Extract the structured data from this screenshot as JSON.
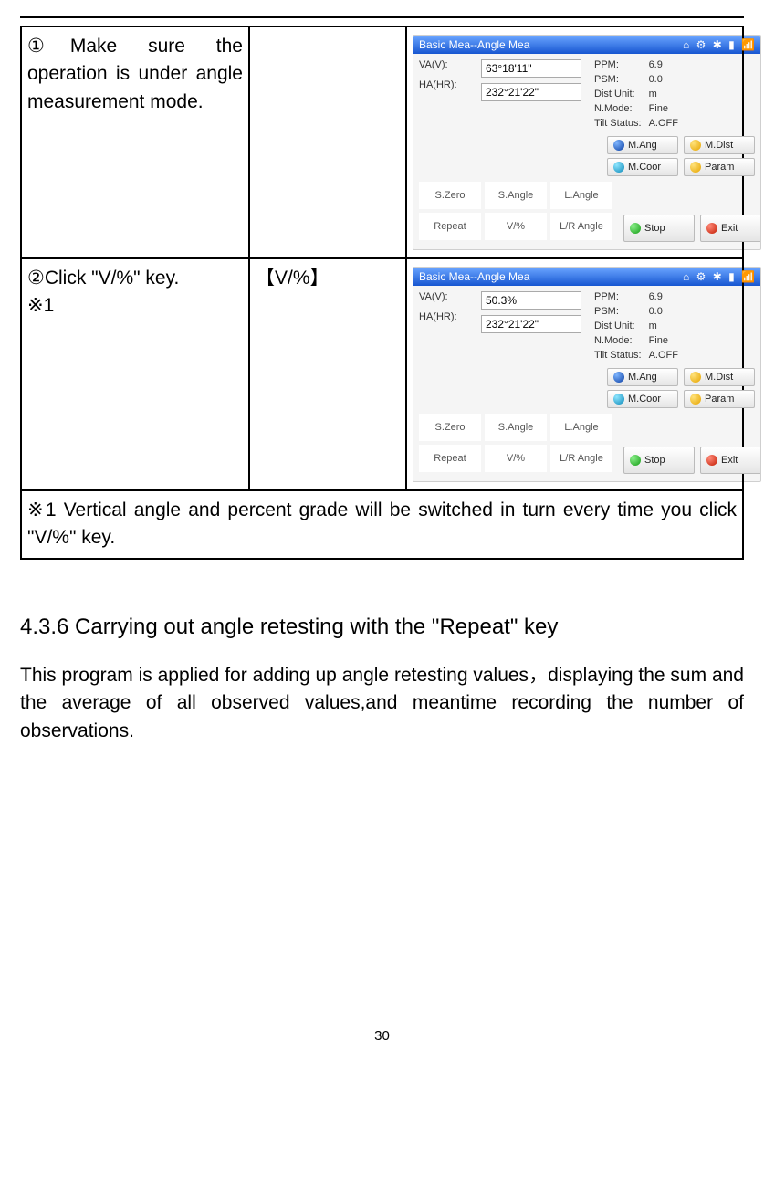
{
  "rule": {},
  "table": {
    "row1": {
      "desc": "①Make sure the operation is under angle measurement mode.",
      "key": ""
    },
    "row2": {
      "desc_line1": "②Click \"V/%\" key.",
      "desc_line2": "※1",
      "key": "【V/%】"
    },
    "note": "※1 Vertical angle and percent grade will be switched in turn every time you click \"V/%\" key."
  },
  "section": {
    "title": "4.3.6 Carrying out angle retesting with the \"Repeat\" key",
    "para": "This program is applied for adding up angle retesting values，displaying the sum and the average of all observed values,and meantime recording the number of observations."
  },
  "page_number": "30",
  "device_common": {
    "title": "Basic Mea--Angle Mea",
    "status_icons": {
      "home": "⌂",
      "gear": "⚙",
      "bt": "✱",
      "bat": "▮",
      "sig": "📶"
    },
    "labels": {
      "va": "VA(V):",
      "ha": "HA(HR):",
      "ppm": "PPM:",
      "psm": "PSM:",
      "dist": "Dist Unit:",
      "nmode": "N.Mode:",
      "tilt": "Tilt Status:"
    },
    "stats": {
      "ppm": "6.9",
      "psm": "0.0",
      "dist": "m",
      "nmode": "Fine",
      "tilt": "A.OFF"
    },
    "buttons": {
      "mang": "M.Ang",
      "mdist": "M.Dist",
      "mcoor": "M.Coor",
      "param": "Param",
      "stop": "Stop",
      "exit": "Exit"
    },
    "softkeys": {
      "szero": "S.Zero",
      "sangle": "S.Angle",
      "langle": "L.Angle",
      "repeat": "Repeat",
      "vp": "V/%",
      "lr": "L/R Angle"
    }
  },
  "device1": {
    "va": "63°18'11\"",
    "ha": "232°21'22\""
  },
  "device2": {
    "va": "50.3%",
    "ha": "232°21'22\""
  }
}
